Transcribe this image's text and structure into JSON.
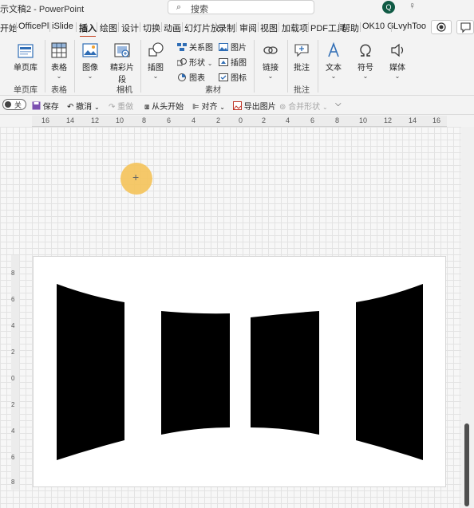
{
  "titlebar": {
    "doc_title": "示文稿2 - PowerPoint",
    "search_placeholder": "搜索",
    "avatar_letter": "Q"
  },
  "tabs": [
    "开始",
    "OfficePl",
    "iSlide",
    "插入",
    "绘图",
    "设计",
    "切换",
    "动画",
    "幻灯片放",
    "录制",
    "审阅",
    "视图",
    "加载项",
    "PDF工具",
    "帮助",
    "OK10 G",
    "LvyhToo"
  ],
  "active_tab": "插入",
  "ribbon": {
    "groups": [
      {
        "label": "单页库",
        "items": [
          "单页库"
        ]
      },
      {
        "label": "表格",
        "items": [
          "表格"
        ]
      },
      {
        "label": "相机",
        "items": [
          "图像",
          "精彩片段"
        ]
      },
      {
        "label": "素材",
        "items": [
          "插图",
          "关系图",
          "形状",
          "图表",
          "图片",
          "插图",
          "图标"
        ]
      },
      {
        "label": "",
        "items": [
          "链接"
        ]
      },
      {
        "label": "批注",
        "items": [
          "批注"
        ]
      },
      {
        "label": "",
        "items": [
          "文本",
          "符号",
          "媒体"
        ]
      }
    ]
  },
  "qat": {
    "toggle_label": "关",
    "items": [
      "保存",
      "撤消",
      "重做",
      "从头开始",
      "对齐",
      "导出图片",
      "合并形状"
    ]
  },
  "ruler": {
    "h_labels": [
      "16",
      "14",
      "12",
      "10",
      "8",
      "6",
      "4",
      "2",
      "0",
      "2",
      "4",
      "6",
      "8",
      "10",
      "12",
      "14",
      "16"
    ],
    "v_labels": [
      "8",
      "6",
      "4",
      "2",
      "0",
      "2",
      "4",
      "6",
      "8"
    ]
  },
  "colors": {
    "accent": "#c43e1c",
    "cursor_highlight": "#f5c45a",
    "shape_fill": "#000000"
  }
}
